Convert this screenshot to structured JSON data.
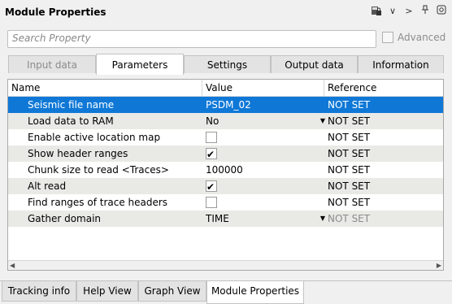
{
  "window": {
    "title": "Module Properties",
    "icons": [
      "save-lock-icon",
      "chevron-down-icon",
      "chevron-right-icon",
      "pin-icon",
      "camera-icon"
    ]
  },
  "search": {
    "placeholder": "Search Property",
    "value": ""
  },
  "advanced": {
    "label": "Advanced",
    "checked": false,
    "enabled": false
  },
  "tabs": [
    {
      "label": "Input data",
      "state": "disabled"
    },
    {
      "label": "Parameters",
      "state": "active"
    },
    {
      "label": "Settings",
      "state": "normal"
    },
    {
      "label": "Output data",
      "state": "normal"
    },
    {
      "label": "Information",
      "state": "normal"
    }
  ],
  "grid": {
    "columns": [
      "Name",
      "Value",
      "Reference"
    ],
    "rows": [
      {
        "name": "Seismic file name",
        "value": "PSDM_02",
        "type": "text",
        "reference": "NOT SET",
        "selected": true
      },
      {
        "name": "Load data to RAM",
        "value": "No",
        "type": "dropdown",
        "reference": "NOT SET"
      },
      {
        "name": "Enable active location map",
        "value": "",
        "type": "checkbox",
        "checked": false,
        "reference": "NOT SET"
      },
      {
        "name": "Show header ranges",
        "value": "",
        "type": "checkbox",
        "checked": true,
        "reference": "NOT SET"
      },
      {
        "name": "Chunk size to read <Traces>",
        "value": "100000",
        "type": "text",
        "reference": "NOT SET"
      },
      {
        "name": "Alt read",
        "value": "",
        "type": "checkbox",
        "checked": true,
        "reference": "NOT SET"
      },
      {
        "name": "Find ranges of trace headers",
        "value": "",
        "type": "checkbox",
        "checked": false,
        "reference": "NOT SET"
      },
      {
        "name": "Gather domain",
        "value": "TIME",
        "type": "dropdown",
        "reference": "NOT SET",
        "reference_muted": true
      }
    ]
  },
  "bottom_tabs": [
    {
      "label": "Tracking info",
      "active": false
    },
    {
      "label": "Help View",
      "active": false
    },
    {
      "label": "Graph View",
      "active": false
    },
    {
      "label": "Module Properties",
      "active": true
    }
  ],
  "colors": {
    "selection": "#0f78d7",
    "alt_row": "#e9e9e6"
  }
}
